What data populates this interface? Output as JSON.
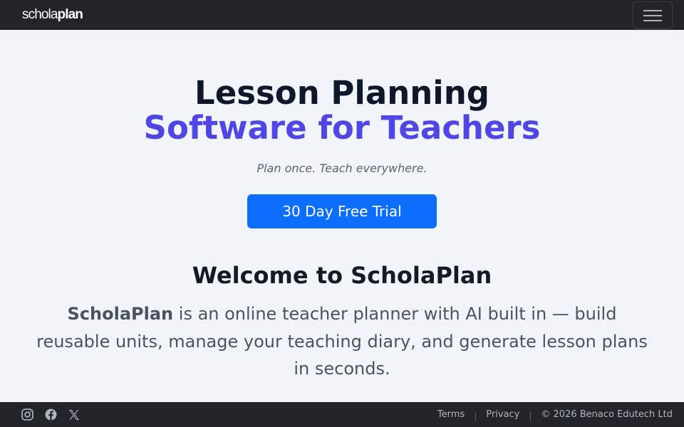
{
  "navbar": {
    "brand_part1": "schola",
    "brand_part2": "plan",
    "menu_icon": "hamburger-menu-icon"
  },
  "hero": {
    "title_line1": "Lesson Planning",
    "title_line2": "Software for Teachers",
    "tagline": "Plan once. Teach everywhere.",
    "cta_label": "30 Day Free Trial"
  },
  "welcome": {
    "heading": "Welcome to ScholaPlan",
    "brand_strong": "ScholaPlan",
    "description": " is an online teacher planner with AI built in — build reusable units, manage your teaching diary, and generate lesson plans in seconds."
  },
  "footer": {
    "social_icons": [
      "instagram-icon",
      "facebook-icon",
      "x-icon"
    ],
    "terms": "Terms",
    "separator": "|",
    "privacy": "Privacy",
    "copyright": "© 2026 Benaco Edutech Ltd"
  },
  "colors": {
    "navbar_bg": "#212529",
    "page_bg": "#f1f5f9",
    "accent_purple": "#4f46e5",
    "cta_blue": "#0d6efd"
  }
}
